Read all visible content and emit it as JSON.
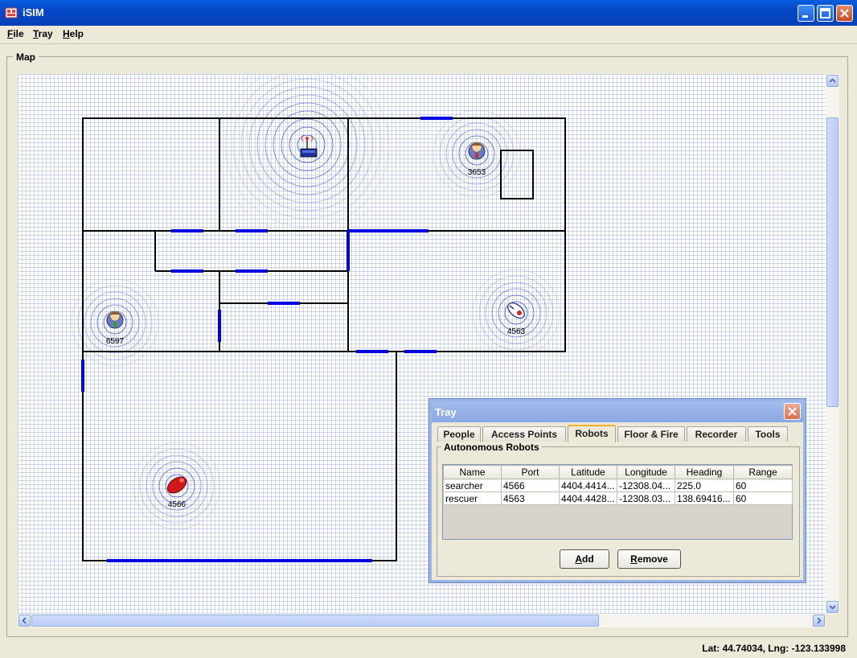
{
  "window": {
    "title": "iSIM"
  },
  "menu": [
    {
      "label": "File",
      "mnemonic": "F",
      "rest": "ile"
    },
    {
      "label": "Tray",
      "mnemonic": "T",
      "rest": "ray"
    },
    {
      "label": "Help",
      "mnemonic": "H",
      "rest": "elp"
    }
  ],
  "map": {
    "panel_label": "Map",
    "entities": [
      {
        "kind": "access-point",
        "label": ""
      },
      {
        "kind": "person",
        "label": "3653"
      },
      {
        "kind": "person",
        "label": "6597"
      },
      {
        "kind": "robot-rescuer",
        "label": "4563"
      },
      {
        "kind": "robot-searcher",
        "label": "4566"
      }
    ]
  },
  "status": {
    "text": "Lat: 44.74034,  Lng: -123.133998"
  },
  "tray": {
    "title": "Tray",
    "tabs": [
      "People",
      "Access Points",
      "Robots",
      "Floor & Fire",
      "Recorder",
      "Tools"
    ],
    "active_tab": "Robots",
    "group_label": "Autonomous Robots",
    "columns": [
      "Name",
      "Port",
      "Latitude",
      "Longitude",
      "Heading",
      "Range"
    ],
    "rows": [
      [
        "searcher",
        "4566",
        "4404.4414...",
        "-12308.04...",
        "225.0",
        "60"
      ],
      [
        "rescuer",
        "4563",
        "4404.4428...",
        "-12308.03...",
        "138.69416...",
        "60"
      ]
    ],
    "buttons": [
      {
        "label": "Add",
        "mnemonic": "A",
        "rest": "dd"
      },
      {
        "label": "Remove",
        "mnemonic": "R",
        "rest": "emove"
      }
    ]
  },
  "colors": {
    "title_bar": "#0548c8",
    "door": "#0000e0",
    "signal_ring": "#3344cc",
    "tray_title": "#8ca8e4"
  }
}
